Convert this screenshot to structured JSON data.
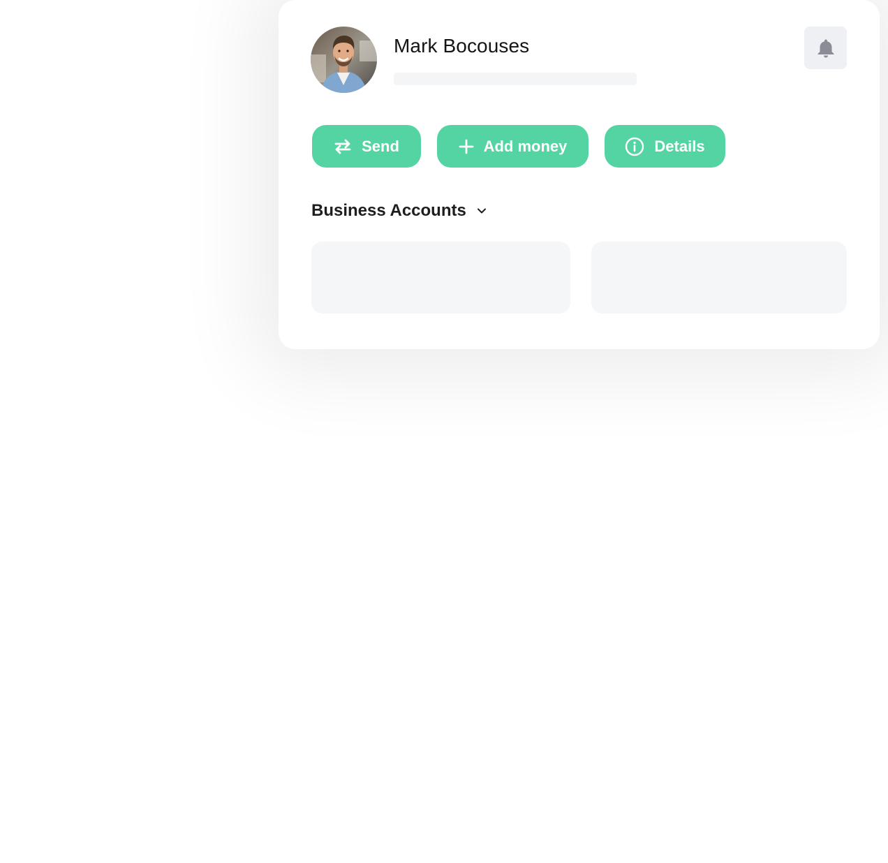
{
  "profile": {
    "name": "Mark Bocouses",
    "avatar_icon": "user-photo-avatar"
  },
  "header": {
    "notification_icon": "bell-icon"
  },
  "actions": {
    "send_label": "Send",
    "send_icon": "swap-arrows-icon",
    "add_money_label": "Add money",
    "add_money_icon": "plus-icon",
    "details_label": "Details",
    "details_icon": "info-circle-icon"
  },
  "business_accounts": {
    "title": "Business Accounts",
    "toggle_icon": "chevron-down-icon"
  },
  "colors": {
    "accent": "#55d4a3",
    "skeleton": "#f5f6f8",
    "icon_gray": "#8a8d98"
  }
}
